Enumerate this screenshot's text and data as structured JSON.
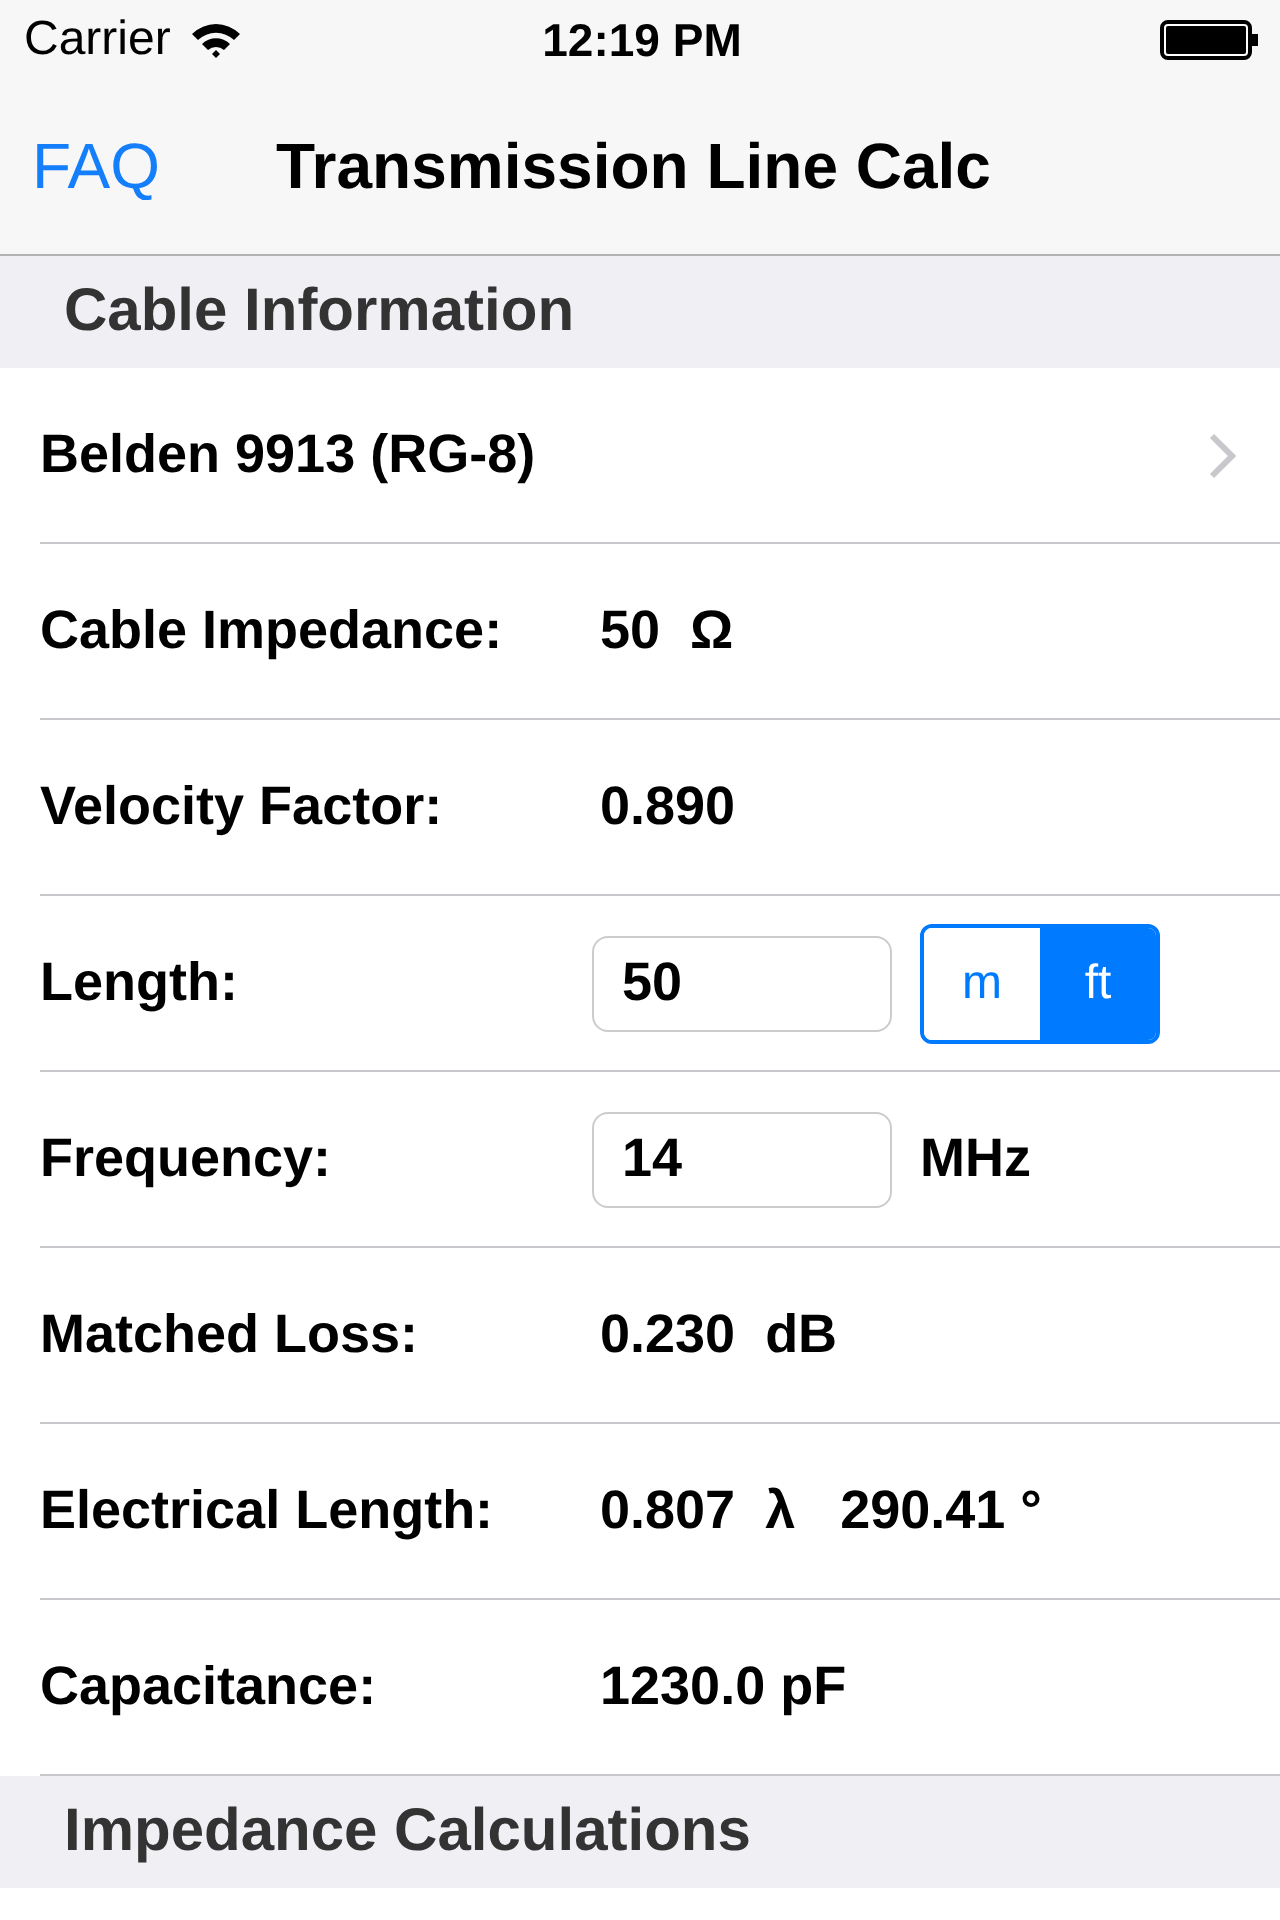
{
  "status_bar": {
    "carrier": "Carrier",
    "time": "12:19 PM"
  },
  "nav_bar": {
    "back": "FAQ",
    "title": "Transmission Line Calc"
  },
  "sections": [
    {
      "title": "Cable Information",
      "rows": [
        {
          "kind": "link",
          "label": "Belden 9913 (RG-8)"
        },
        {
          "kind": "value",
          "label": "Cable Impedance:",
          "value": "50  Ω"
        },
        {
          "kind": "value",
          "label": "Velocity Factor:",
          "value": "0.890"
        },
        {
          "kind": "field",
          "label": "Length:",
          "value": "50",
          "segments": [
            {
              "label": "m",
              "selected": false
            },
            {
              "label": "ft",
              "selected": true
            }
          ]
        },
        {
          "kind": "field",
          "label": "Frequency:",
          "value": "14",
          "unit": "MHz"
        },
        {
          "kind": "value",
          "label": "Matched Loss:",
          "value": "0.230  dB"
        },
        {
          "kind": "value",
          "label": "Electrical Length:",
          "value": "0.807  λ   290.41 °"
        },
        {
          "kind": "value",
          "label": "Capacitance:",
          "value": "1230.0 pF"
        }
      ]
    },
    {
      "title": "Impedance Calculations"
    }
  ]
}
